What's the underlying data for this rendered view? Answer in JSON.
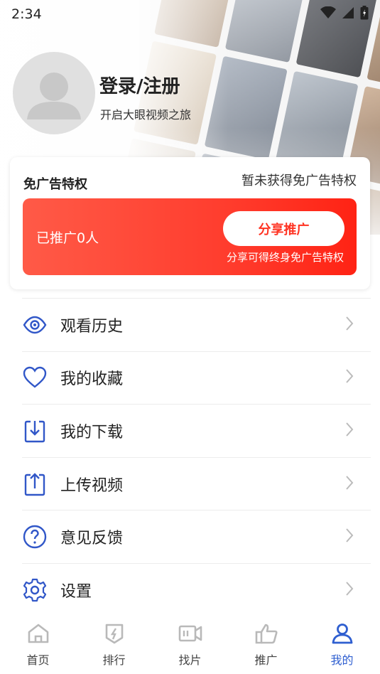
{
  "status_bar": {
    "time": "2:34"
  },
  "profile": {
    "login_title": "登录/注册",
    "subtitle": "开启大眼视频之旅"
  },
  "ad_card": {
    "title": "免广告特权",
    "status": "暂未获得免广告特权",
    "promo_count": "已推广0人",
    "share_button": "分享推广",
    "share_hint": "分享可得终身免广告特权"
  },
  "menu": {
    "items": [
      {
        "label": "观看历史",
        "icon": "eye-icon"
      },
      {
        "label": "我的收藏",
        "icon": "heart-icon"
      },
      {
        "label": "我的下载",
        "icon": "download-icon"
      },
      {
        "label": "上传视频",
        "icon": "upload-icon"
      },
      {
        "label": "意见反馈",
        "icon": "question-icon"
      },
      {
        "label": "设置",
        "icon": "gear-icon"
      }
    ]
  },
  "bottom_nav": {
    "items": [
      {
        "label": "首页",
        "icon": "home-icon"
      },
      {
        "label": "排行",
        "icon": "ranking-icon"
      },
      {
        "label": "找片",
        "icon": "video-camera-icon"
      },
      {
        "label": "推广",
        "icon": "thumbs-up-icon"
      },
      {
        "label": "我的",
        "icon": "user-icon",
        "active": true
      }
    ]
  },
  "colors": {
    "accent": "#2f5fd0",
    "promo": "#ff3d2e",
    "icon_inactive": "#b9b9b9"
  }
}
